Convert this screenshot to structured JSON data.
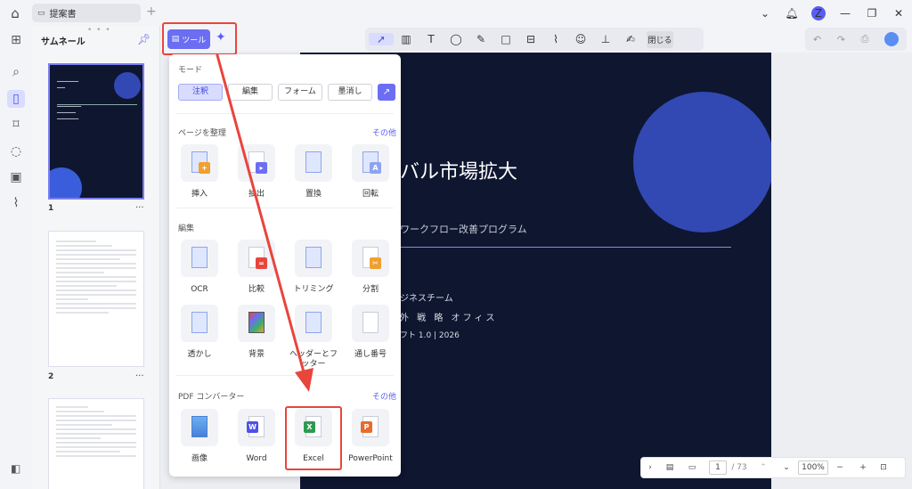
{
  "titlebar": {
    "tab_title": "提案書",
    "avatar_letter": "Z"
  },
  "thumbnails": {
    "header": "サムネール",
    "pages": [
      {
        "number": "1",
        "more": "···"
      },
      {
        "number": "2",
        "more": "···"
      }
    ]
  },
  "toolbar": {
    "tools_label": "ツール",
    "close_label": "閉じる"
  },
  "panel": {
    "mode_label": "モード",
    "modes": [
      "注釈",
      "編集",
      "フォーム",
      "墨消し"
    ],
    "organize_label": "ページを整理",
    "organize_more": "その他",
    "organize_items": [
      "挿入",
      "抽出",
      "置換",
      "回転"
    ],
    "edit_label": "編集",
    "edit_items": [
      "OCR",
      "比較",
      "トリミング",
      "分割",
      "透かし",
      "背景",
      "ヘッダーとフッター",
      "通し番号"
    ],
    "convert_label": "PDF コンバーター",
    "convert_more": "その他",
    "convert_items": [
      "画像",
      "Word",
      "Excel",
      "PowerPoint"
    ]
  },
  "slide": {
    "title": "バル市場拡大",
    "subtitle": "ワークフロー改善プログラム",
    "meta1": "ジネスチーム",
    "meta2": "外 戦 略 オフィス",
    "meta3": "フト 1.0 | 2026"
  },
  "bottombar": {
    "current_page": "1",
    "total_pages": "/ 73",
    "zoom": "100%"
  },
  "colors": {
    "accent": "#6b6ef3",
    "highlight_red": "#e8453c",
    "slide_bg": "#0e1630",
    "slide_circle": "#3248b3"
  }
}
